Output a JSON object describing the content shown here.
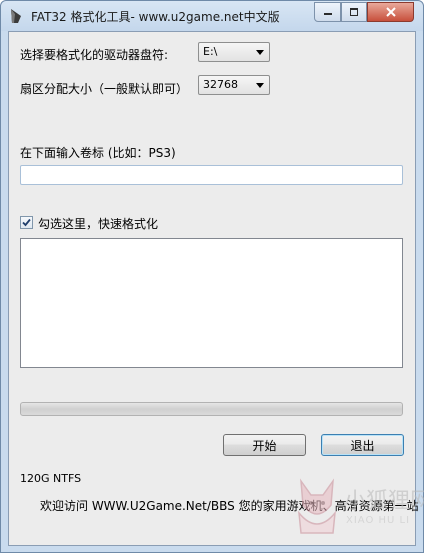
{
  "window": {
    "title": "FAT32 格式化工具- www.u2game.net中文版"
  },
  "form": {
    "drive_label": "选择要格式化的驱动器盘符:",
    "drive_value": "E:\\",
    "cluster_label": "扇区分配大小（一般默认即可）",
    "cluster_value": "32768",
    "volume_label": "在下面输入卷标 (比如：PS3)",
    "volume_value": "",
    "quick_format_label": "勾选这里，快速格式化",
    "quick_format_checked": true
  },
  "progress": {
    "value": 0
  },
  "buttons": {
    "start": "开始",
    "exit": "退出"
  },
  "status": {
    "disk_info": "120G NTFS"
  },
  "footer": {
    "text": "欢迎访问 WWW.U2Game.Net/BBS 您的家用游戏机、高清资源第一站"
  },
  "watermark": {
    "cn": "小狐狸网",
    "en": "XIAO HU LI"
  }
}
